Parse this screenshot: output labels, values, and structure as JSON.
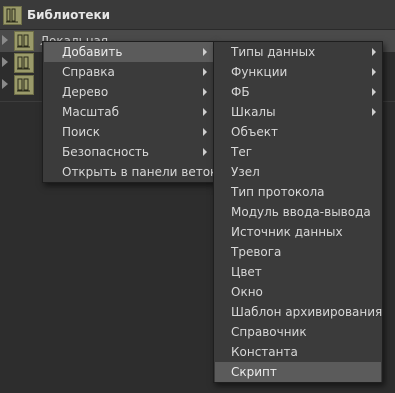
{
  "panel": {
    "title": "Библиотеки",
    "icon": "library-icon"
  },
  "tree": {
    "items": [
      {
        "label": "Локальная",
        "icon": "library-node-icon",
        "expander": "collapsed"
      },
      {
        "label": "",
        "icon": "library-node-icon",
        "expander": "collapsed"
      },
      {
        "label": "",
        "icon": "library-node-icon",
        "expander": "collapsed"
      }
    ]
  },
  "context_menu": {
    "items": [
      {
        "label": "Добавить",
        "submenu": true,
        "highlighted": true
      },
      {
        "label": "Справка",
        "submenu": true
      },
      {
        "label": "Дерево",
        "submenu": true
      },
      {
        "label": "Масштаб",
        "submenu": true
      },
      {
        "label": "Поиск",
        "submenu": true
      },
      {
        "label": "Безопасность",
        "submenu": true
      },
      {
        "label": "Открыть в панели веток",
        "submenu": false
      }
    ]
  },
  "add_submenu": {
    "items": [
      {
        "label": "Типы данных",
        "submenu": true
      },
      {
        "label": "Функции",
        "submenu": true
      },
      {
        "label": "ФБ",
        "submenu": true
      },
      {
        "label": "Шкалы",
        "submenu": true
      },
      {
        "label": "Объект",
        "submenu": false
      },
      {
        "label": "Тег",
        "submenu": false
      },
      {
        "label": "Узел",
        "submenu": false
      },
      {
        "label": "Тип протокола",
        "submenu": false
      },
      {
        "label": "Модуль ввода-вывода",
        "submenu": false
      },
      {
        "label": "Источник данных",
        "submenu": false
      },
      {
        "label": "Тревога",
        "submenu": false
      },
      {
        "label": "Цвет",
        "submenu": false
      },
      {
        "label": "Окно",
        "submenu": false
      },
      {
        "label": "Шаблон архивирования",
        "submenu": false
      },
      {
        "label": "Справочник",
        "submenu": false
      },
      {
        "label": "Константа",
        "submenu": false
      },
      {
        "label": "Скрипт",
        "submenu": false,
        "highlighted": true
      }
    ]
  },
  "colors": {
    "background": "#2d2d2d",
    "menu_background": "#3b3b3b",
    "menu_highlight": "#5b5b5b",
    "icon_fill": "#9a9a6a"
  }
}
